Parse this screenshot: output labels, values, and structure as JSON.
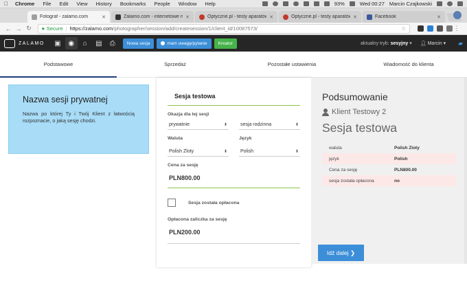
{
  "menubar": {
    "items": [
      "Chrome",
      "File",
      "Edit",
      "View",
      "History",
      "Bookmarks",
      "People",
      "Window",
      "Help"
    ],
    "battery": "93%",
    "clock": "Wed 00:27",
    "user": "Marcin Czajkowski"
  },
  "tabs": [
    {
      "title": "Fotograf - zalamo.com",
      "color": "#9e9e9e"
    },
    {
      "title": "Zalamo.com - internetowe na",
      "color": "#333333"
    },
    {
      "title": "Optyczne.pl - testy aparatów",
      "color": "#c0392b"
    },
    {
      "title": "Optyczne.pl - testy aparatów",
      "color": "#c0392b"
    },
    {
      "title": "Facebook",
      "color": "#3b5998"
    }
  ],
  "address": {
    "secure_label": "Secure",
    "url_host": "https://zalamo.com",
    "url_path": "/photographer/session/add/createsession/1/client_id/10087573/"
  },
  "header": {
    "logo_text": "ZALAMO",
    "btn_new_session": "Nowa sesja",
    "btn_question": "mam uwagę/pytanie",
    "btn_creator": "Kreator",
    "mode_label": "aktualny tryb:",
    "mode_value": "sesyjny",
    "user": "Marcin",
    "accent_blue": "#3d8ed8",
    "accent_green": "#46b34b"
  },
  "page_tabs": [
    "Podstawowe",
    "Sprzedaż",
    "Pozostałe ustawienia",
    "Wiadomość do klienta"
  ],
  "info": {
    "title": "Nazwa sesji prywatnej",
    "text": "Nazwa po której Ty i Twój Klient z łatwością rozpoznacie, o jaką sesję chodzi."
  },
  "form": {
    "session_name": "Sesja testowa",
    "occasion_label": "Okazja dla tej sesji",
    "occasion_1": "prywatnie",
    "occasion_2": "sesja rodzinna",
    "currency_label": "Waluta",
    "currency_value": "Polish Zloty",
    "language_label": "Język",
    "language_value": "Polish",
    "price_label": "Cena za sesję",
    "price_value": "PLN800.00",
    "paid_label": "Sesja została opłacona",
    "deposit_label": "Opłacona zaliczka za sesję",
    "deposit_value": "PLN200.00"
  },
  "summary": {
    "title": "Podsumowanie",
    "client": "Klient Testowy 2",
    "session": "Sesja testowa",
    "rows": [
      {
        "k": "waluta",
        "v": "Polish Zloty"
      },
      {
        "k": "język",
        "v": "Polish"
      },
      {
        "k": "Cena za sesję",
        "v": "PLN800.00"
      },
      {
        "k": "sesja została opłacona",
        "v": "no"
      }
    ]
  },
  "next_button": "Idź dalej"
}
